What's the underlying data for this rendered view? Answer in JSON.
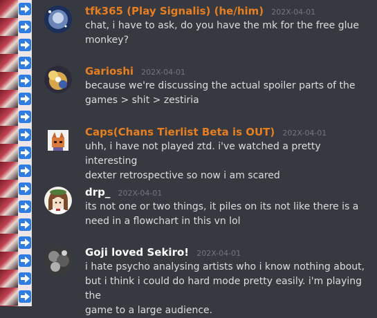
{
  "messages": [
    {
      "username": "tfk365 (Play Signalis) (he/him)",
      "username_color": "#e67e22",
      "timestamp": "202X-04-01",
      "lines": [
        "chat, i have to ask, do you have the mk for the free glue",
        "monkey?"
      ],
      "avatar": "astronaut-avatar"
    },
    {
      "username": "Garioshi",
      "username_color": "#e67e22",
      "timestamp": "202X-04-01",
      "lines": [
        "because we're discussing the actual spoiler parts of the",
        "games > shit > zestiria"
      ],
      "avatar": "character-avatar"
    },
    {
      "username": "Caps(Chans Tierlist Beta is OUT)",
      "username_color": "#e67e22",
      "timestamp": "202X-04-01",
      "lines": [
        "uhh, i have not played ztd. i've watched a pretty interesting",
        "dexter retrospective so now i am scared"
      ],
      "avatar": "fox-avatar"
    },
    {
      "username": "drp_",
      "username_color": "#ffffff",
      "timestamp": "202X-04-01",
      "lines": [
        "its not one or two things, it piles on its not like there is a",
        "need in a flowchart in this vn lol"
      ],
      "avatar": "anime-girl-avatar"
    },
    {
      "username": "Goji loved Sekiro!",
      "username_color": "#ffffff",
      "timestamp": "202X-04-01",
      "lines": [
        "i hate psycho analysing artists who i know nothing about,",
        "but i think i could do hard mode pretty easily. i'm playing the",
        "game to a large audience."
      ],
      "avatar": "monochrome-avatar"
    }
  ]
}
